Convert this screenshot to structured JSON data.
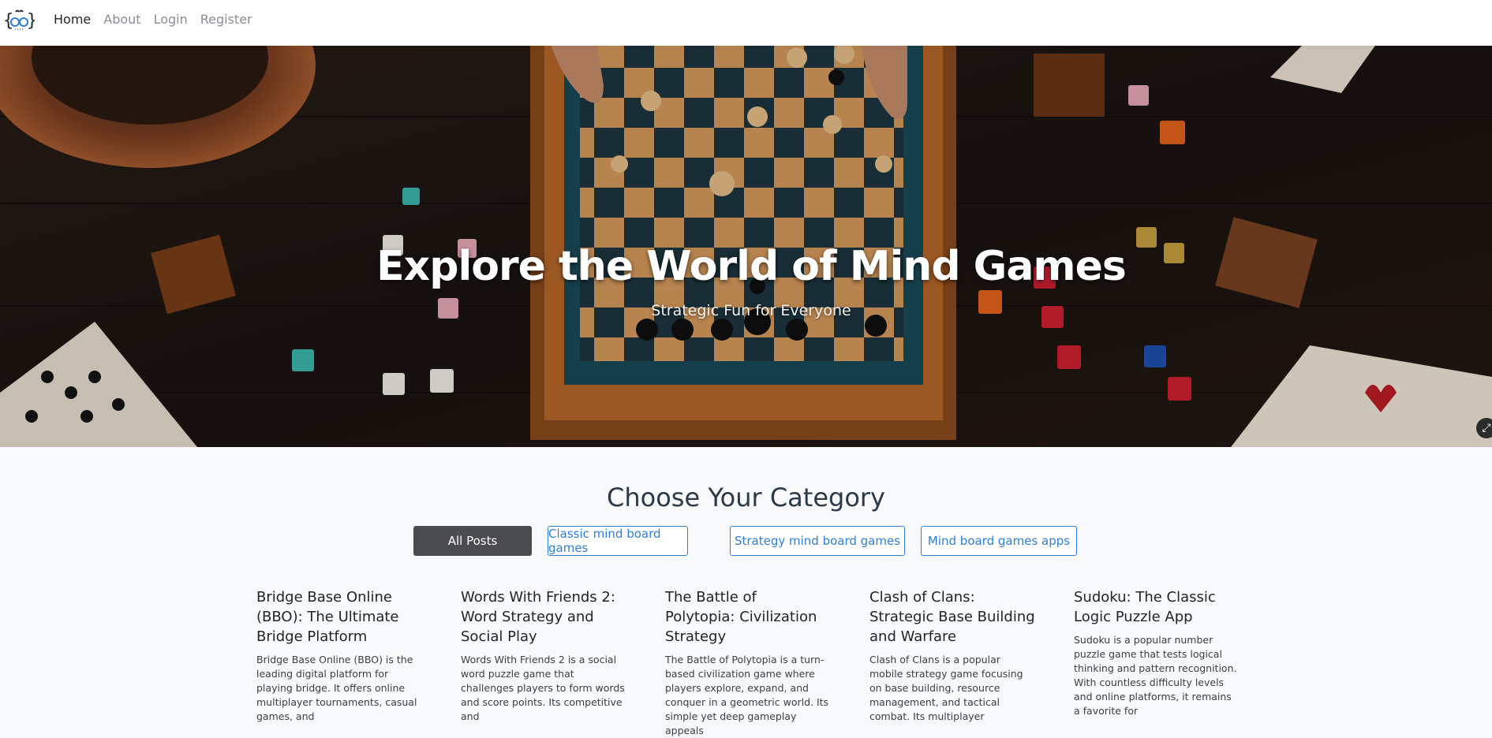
{
  "navbar": {
    "brand_icon": "quote-braces-logo-icon",
    "links": [
      {
        "label": "Home",
        "active": true
      },
      {
        "label": "About",
        "active": false
      },
      {
        "label": "Login",
        "active": false
      },
      {
        "label": "Register",
        "active": false
      }
    ]
  },
  "hero": {
    "title": "Explore the World of Mind Games",
    "subtitle": "Strategic Fun for Everyone",
    "background_description_icon": "board-games-photo"
  },
  "categories": {
    "title": "Choose Your Category",
    "filters": [
      {
        "label": "All Posts",
        "selected": true
      },
      {
        "label": "Classic mind board games",
        "selected": false
      },
      {
        "label": "Strategy mind board games",
        "selected": false
      },
      {
        "label": "Mind board games apps",
        "selected": false
      }
    ],
    "accent_color": "#2f7fd8",
    "selected_color": "#4a4c50"
  },
  "posts": [
    {
      "title": "Bridge Base Online (BBO): The Ultimate Bridge Platform",
      "excerpt": "Bridge Base Online (BBO) is the leading digital platform for playing bridge. It offers online multiplayer tournaments, casual games, and"
    },
    {
      "title": "Words With Friends 2: Word Strategy and Social Play",
      "excerpt": "Words With Friends 2 is a social word puzzle game that challenges players to form words and score points. Its competitive and"
    },
    {
      "title": "The Battle of Polytopia: Civilization Strategy",
      "excerpt": "The Battle of Polytopia is a turn-based civilization game where players explore, expand, and conquer in a geometric world. Its simple yet deep gameplay appeals"
    },
    {
      "title": "Clash of Clans: Strategic Base Building and Warfare",
      "excerpt": "Clash of Clans is a popular mobile strategy game focusing on base building, resource management, and tactical combat. Its multiplayer"
    },
    {
      "title": "Sudoku: The Classic Logic Puzzle App",
      "excerpt": "Sudoku is a popular number puzzle game that tests logical thinking and pattern recognition. With countless difficulty levels and online platforms, it remains a favorite for"
    }
  ]
}
